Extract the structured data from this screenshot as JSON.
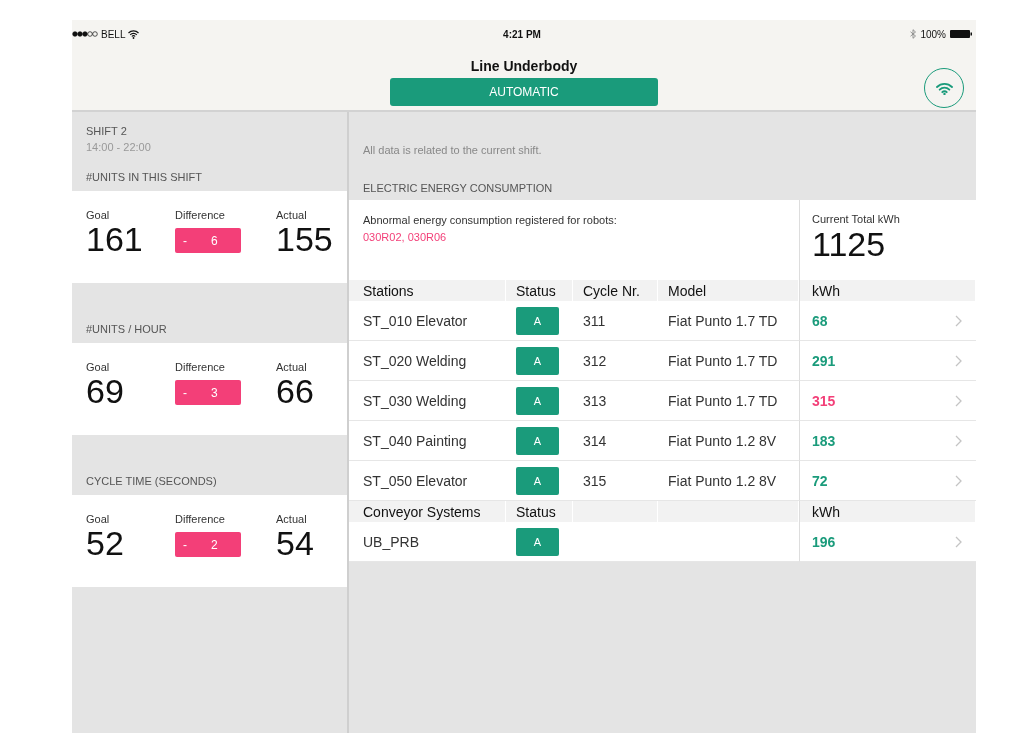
{
  "status_bar": {
    "carrier": "BELL",
    "time": "4:21 PM",
    "battery": "100%"
  },
  "header": {
    "title": "Line Underbody",
    "mode": "AUTOMATIC"
  },
  "shift": {
    "name": "SHIFT 2",
    "hours": "14:00 - 22:00"
  },
  "kpis": [
    {
      "title": "#UNITS IN THIS SHIFT",
      "goal_label": "Goal",
      "goal": "161",
      "difference_label": "Difference",
      "difference_sign": "-",
      "difference": "6",
      "actual_label": "Actual",
      "actual": "155"
    },
    {
      "title": "#UNITS / HOUR",
      "goal_label": "Goal",
      "goal": "69",
      "difference_label": "Difference",
      "difference_sign": "-",
      "difference": "3",
      "actual_label": "Actual",
      "actual": "66"
    },
    {
      "title": "CYCLE TIME (SECONDS)",
      "goal_label": "Goal",
      "goal": "52",
      "difference_label": "Difference",
      "difference_sign": "-",
      "difference": "2",
      "actual_label": "Actual",
      "actual": "54"
    }
  ],
  "note": "All data is related to the current shift.",
  "energy": {
    "title": "ELECTRIC ENERGY CONSUMPTION",
    "alert": "Abnormal energy consumption registered for robots:",
    "alert_robots": "030R02, 030R06",
    "total_label": "Current Total kWh",
    "total": "1125"
  },
  "stations": {
    "columns": [
      "Stations",
      "Status",
      "Cycle Nr.",
      "Model",
      "kWh"
    ],
    "rows": [
      {
        "name": "ST_010 Elevator",
        "status": "A",
        "cycle": "311",
        "model": "Fiat Punto 1.7 TD",
        "kwh": "68",
        "abnormal": false
      },
      {
        "name": "ST_020 Welding",
        "status": "A",
        "cycle": "312",
        "model": "Fiat Punto 1.7 TD",
        "kwh": "291",
        "abnormal": false
      },
      {
        "name": "ST_030 Welding",
        "status": "A",
        "cycle": "313",
        "model": "Fiat Punto 1.7 TD",
        "kwh": "315",
        "abnormal": true
      },
      {
        "name": "ST_040 Painting",
        "status": "A",
        "cycle": "314",
        "model": "Fiat Punto 1.2 8V",
        "kwh": "183",
        "abnormal": false
      },
      {
        "name": "ST_050 Elevator",
        "status": "A",
        "cycle": "315",
        "model": "Fiat Punto 1.2 8V",
        "kwh": "72",
        "abnormal": false
      }
    ]
  },
  "conveyors": {
    "columns": [
      "Conveyor Systems",
      "Status",
      "kWh"
    ],
    "rows": [
      {
        "name": "UB_PRB",
        "status": "A",
        "kwh": "196",
        "abnormal": false
      }
    ]
  }
}
